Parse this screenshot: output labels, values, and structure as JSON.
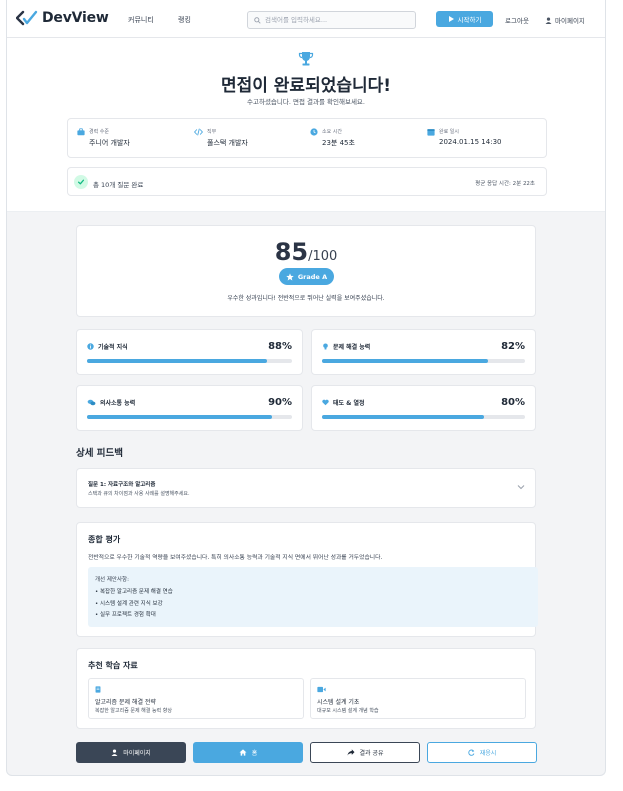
{
  "nav": {
    "logo": "DevView",
    "links": [
      "커뮤니티",
      "랭킹"
    ],
    "search_placeholder": "검색어를 입력하세요...",
    "start_button": "시작하기",
    "logout": "로그아웃",
    "mypage": "마이페이지"
  },
  "hero": {
    "title": "면접이 완료되었습니다!",
    "subtitle": "수고하셨습니다. 면접 결과를 확인해보세요.",
    "info": [
      {
        "label": "경력 수준",
        "value": "주니어 개발자",
        "icon": "briefcase-icon"
      },
      {
        "label": "직무",
        "value": "풀스택 개발자",
        "icon": "code-icon"
      },
      {
        "label": "소요 시간",
        "value": "23분 45초",
        "icon": "clock-icon"
      },
      {
        "label": "완료 일시",
        "value": "2024.01.15 14:30",
        "icon": "calendar-icon"
      }
    ],
    "completed": "총 10개 질문 완료",
    "avg_time": "평균 응답 시간: 2분 22초"
  },
  "score": {
    "value": "85",
    "max": "/100",
    "grade": "Grade A",
    "description": "우수한 성과입니다! 전반적으로 뛰어난 실력을 보여주셨습니다."
  },
  "metrics": [
    {
      "label": "기술적 지식",
      "value": "88%",
      "percent": 88,
      "icon": "info-icon"
    },
    {
      "label": "문제 해결 능력",
      "value": "82%",
      "percent": 82,
      "icon": "lightbulb-icon"
    },
    {
      "label": "의사소통 능력",
      "value": "90%",
      "percent": 90,
      "icon": "chat-icon"
    },
    {
      "label": "태도 & 열정",
      "value": "80%",
      "percent": 80,
      "icon": "heart-icon"
    }
  ],
  "feedback": {
    "title": "상세 피드백",
    "question_title": "질문 1: 자료구조와 알고리즘",
    "question_sub": "스택과 큐의 차이점과 사용 사례를 설명해주세요."
  },
  "summary": {
    "title": "종합 평가",
    "text": "전반적으로 우수한 기술적 역량을 보여주셨습니다. 특히 의사소통 능력과 기술적 지식 면에서 뛰어난 성과를 거두었습니다.",
    "improve_title": "개선 제안사항:",
    "improve_items": [
      "복잡한 알고리즘 문제 해결 연습",
      "시스템 설계 관련 지식 보강",
      "실무 프로젝트 경험 확대"
    ]
  },
  "recommend": {
    "title": "추천 학습 자료",
    "items": [
      {
        "title": "알고리즘 문제 해결 전략",
        "sub": "복잡한 알고리즘 문제 해결 능력 향상",
        "icon": "book-icon"
      },
      {
        "title": "시스템 설계 기초",
        "sub": "대규모 시스템 설계 개념 학습",
        "icon": "video-icon"
      }
    ]
  },
  "buttons": {
    "mypage": "마이페이지",
    "home": "홈",
    "share": "결과 공유",
    "retry": "재응시"
  },
  "colors": {
    "accent": "#4aa8e0",
    "dark": "#3a4656",
    "success": "#10b981"
  }
}
